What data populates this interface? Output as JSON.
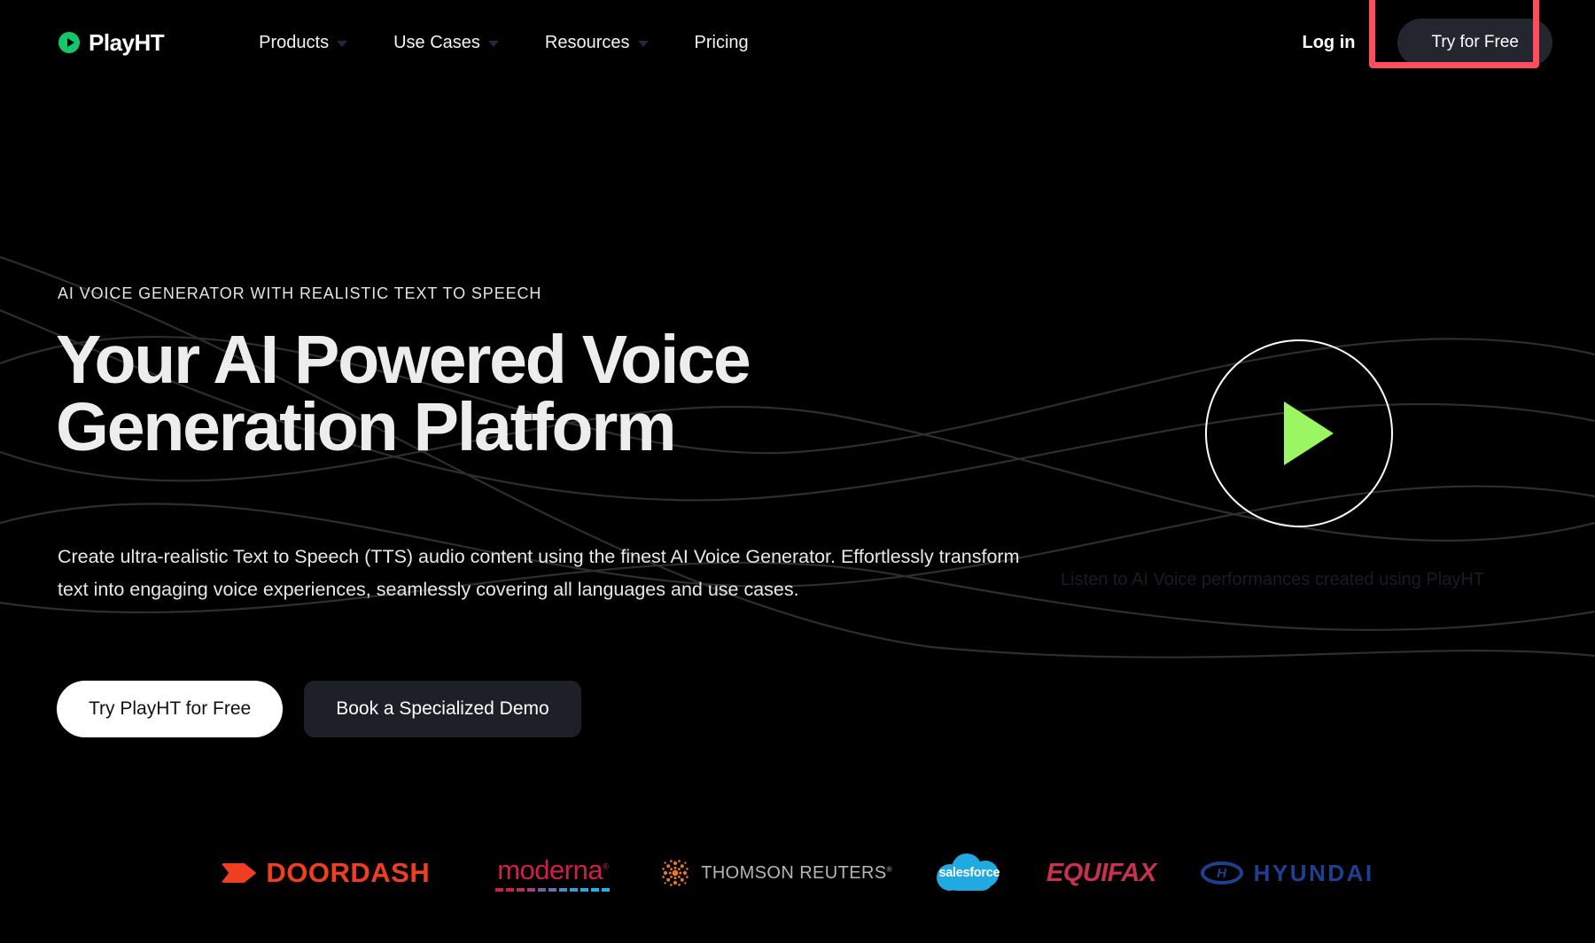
{
  "brand": {
    "name": "PlayHT",
    "logo_icon": "play-circle-icon",
    "accent_color": "#13c56b"
  },
  "nav": {
    "items": [
      {
        "label": "Products",
        "has_dropdown": true
      },
      {
        "label": "Use Cases",
        "has_dropdown": true
      },
      {
        "label": "Resources",
        "has_dropdown": true
      },
      {
        "label": "Pricing",
        "has_dropdown": false
      }
    ]
  },
  "header": {
    "login_label": "Log in",
    "try_label": "Try for Free",
    "highlight_color": "#ff4d5e"
  },
  "hero": {
    "eyebrow": "AI VOICE GENERATOR WITH REALISTIC TEXT TO SPEECH",
    "headline_line1": "Your AI Powered Voice",
    "headline_line2": "Generation Platform",
    "subcopy": "Create ultra-realistic Text to Speech (TTS) audio content using the finest AI Voice Generator. Effortlessly transform text into engaging voice experiences, seamlessly covering all languages and use cases.",
    "primary_cta": "Try PlayHT for Free",
    "secondary_cta": "Book a Specialized Demo"
  },
  "player": {
    "play_icon": "play-triangle-icon",
    "play_color": "#9bf663",
    "caption": "Listen to AI Voice performances created using PlayHT"
  },
  "logos": {
    "items": [
      {
        "name": "DoorDash",
        "text": "DOORDASH",
        "color": "#f03f20"
      },
      {
        "name": "moderna",
        "text": "moderna",
        "color": "#cf1f46"
      },
      {
        "name": "Thomson Reuters",
        "text": "THOMSON REUTERS",
        "color": "#b5b5b5"
      },
      {
        "name": "salesforce",
        "text": "salesforce",
        "color": "#21a9e1"
      },
      {
        "name": "Equifax",
        "text": "EQUIFAX",
        "color": "#c8324d"
      },
      {
        "name": "Hyundai",
        "text": "HYUNDAI",
        "color": "#1f3f92"
      }
    ]
  }
}
